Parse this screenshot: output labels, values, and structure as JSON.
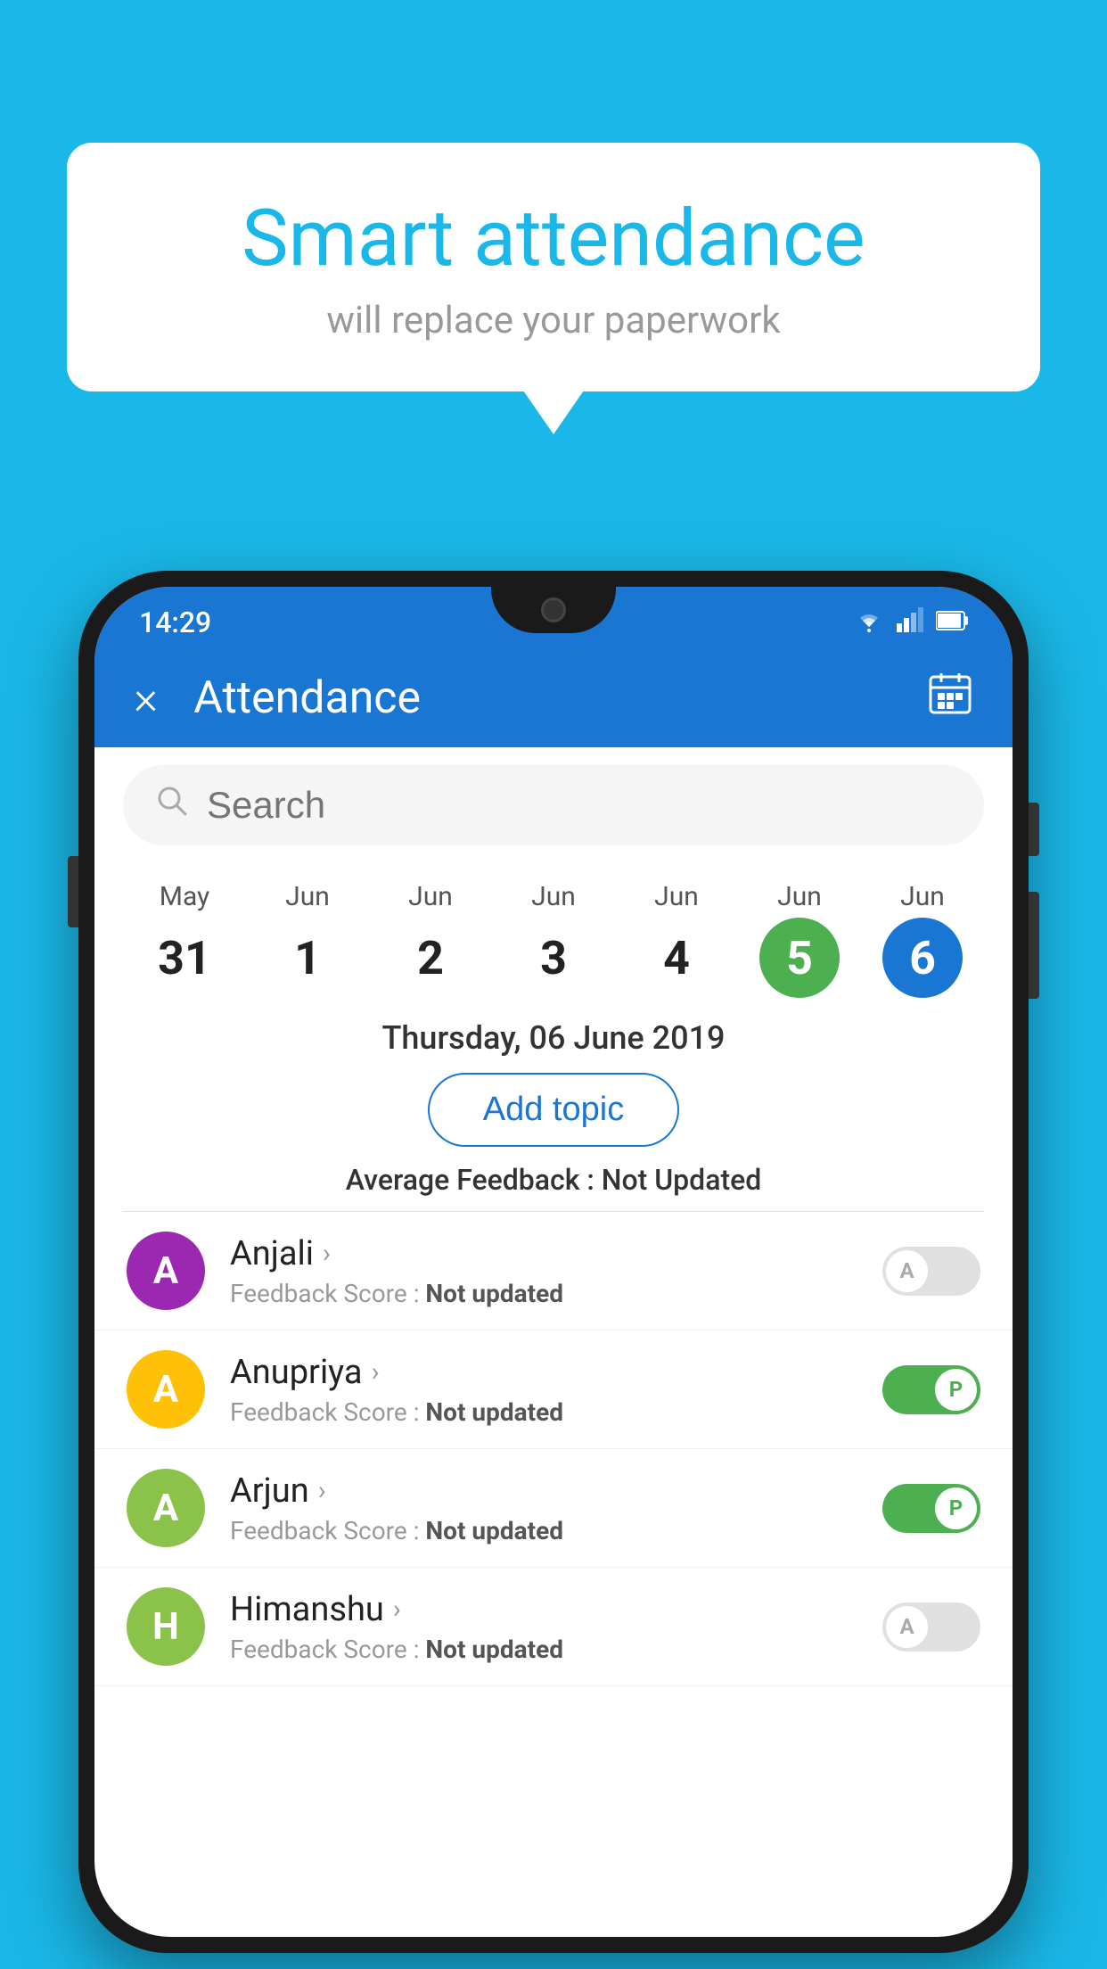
{
  "background_color": "#1ab8e8",
  "bubble": {
    "title": "Smart attendance",
    "subtitle": "will replace your paperwork"
  },
  "status_bar": {
    "time": "14:29",
    "wifi": "▾",
    "signal": "▲",
    "battery": "▮"
  },
  "app_bar": {
    "title": "Attendance",
    "close_label": "×",
    "calendar_label": "📅"
  },
  "search": {
    "placeholder": "Search"
  },
  "dates": [
    {
      "month": "May",
      "day": "31",
      "state": "normal"
    },
    {
      "month": "Jun",
      "day": "1",
      "state": "normal"
    },
    {
      "month": "Jun",
      "day": "2",
      "state": "normal"
    },
    {
      "month": "Jun",
      "day": "3",
      "state": "normal"
    },
    {
      "month": "Jun",
      "day": "4",
      "state": "normal"
    },
    {
      "month": "Jun",
      "day": "5",
      "state": "today"
    },
    {
      "month": "Jun",
      "day": "6",
      "state": "selected"
    }
  ],
  "selected_date": "Thursday, 06 June 2019",
  "add_topic_label": "Add topic",
  "avg_feedback_label": "Average Feedback :",
  "avg_feedback_value": "Not Updated",
  "students": [
    {
      "name": "Anjali",
      "avatar_letter": "A",
      "avatar_color": "#9c27b0",
      "feedback_label": "Feedback Score :",
      "feedback_value": "Not updated",
      "toggle_state": "off",
      "toggle_letter": "A"
    },
    {
      "name": "Anupriya",
      "avatar_letter": "A",
      "avatar_color": "#ffc107",
      "feedback_label": "Feedback Score :",
      "feedback_value": "Not updated",
      "toggle_state": "on",
      "toggle_letter": "P"
    },
    {
      "name": "Arjun",
      "avatar_letter": "A",
      "avatar_color": "#8bc34a",
      "feedback_label": "Feedback Score :",
      "feedback_value": "Not updated",
      "toggle_state": "on",
      "toggle_letter": "P"
    },
    {
      "name": "Himanshu",
      "avatar_letter": "H",
      "avatar_color": "#8bc34a",
      "feedback_label": "Feedback Score :",
      "feedback_value": "Not updated",
      "toggle_state": "off",
      "toggle_letter": "A"
    }
  ]
}
